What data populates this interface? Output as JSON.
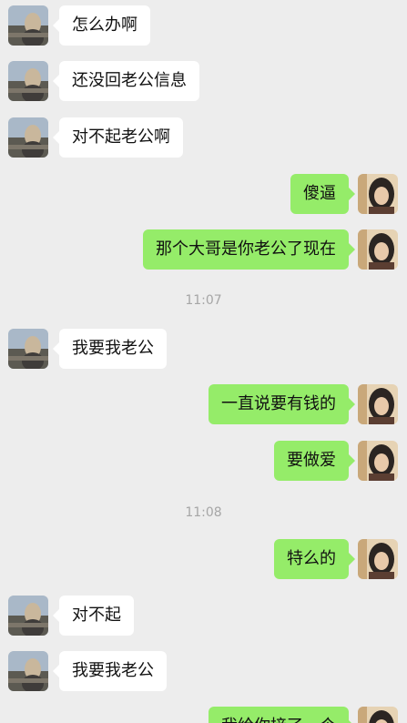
{
  "messages": [
    {
      "side": "in",
      "text": "怎么办啊"
    },
    {
      "side": "in",
      "text": "还没回老公信息"
    },
    {
      "side": "in",
      "text": "对不起老公啊"
    },
    {
      "side": "out",
      "text": "傻逼"
    },
    {
      "side": "out",
      "text": "那个大哥是你老公了现在"
    },
    {
      "side": "in",
      "text": "我要我老公"
    },
    {
      "side": "out",
      "text": "一直说要有钱的"
    },
    {
      "side": "out",
      "text": "要做爱"
    },
    {
      "side": "out",
      "text": "特么的"
    },
    {
      "side": "in",
      "text": "对不起"
    },
    {
      "side": "in",
      "text": "我要我老公"
    },
    {
      "side": "out",
      "text": "我给你接了一个"
    }
  ],
  "timestamps": [
    "11:07",
    "11:08"
  ],
  "colors": {
    "background": "#ededed",
    "incoming_bubble": "#ffffff",
    "outgoing_bubble": "#95ec69",
    "timestamp": "#a6a6a6"
  },
  "icons": {
    "incoming_avatar": "contact-avatar-icon",
    "outgoing_avatar": "self-avatar-icon"
  }
}
